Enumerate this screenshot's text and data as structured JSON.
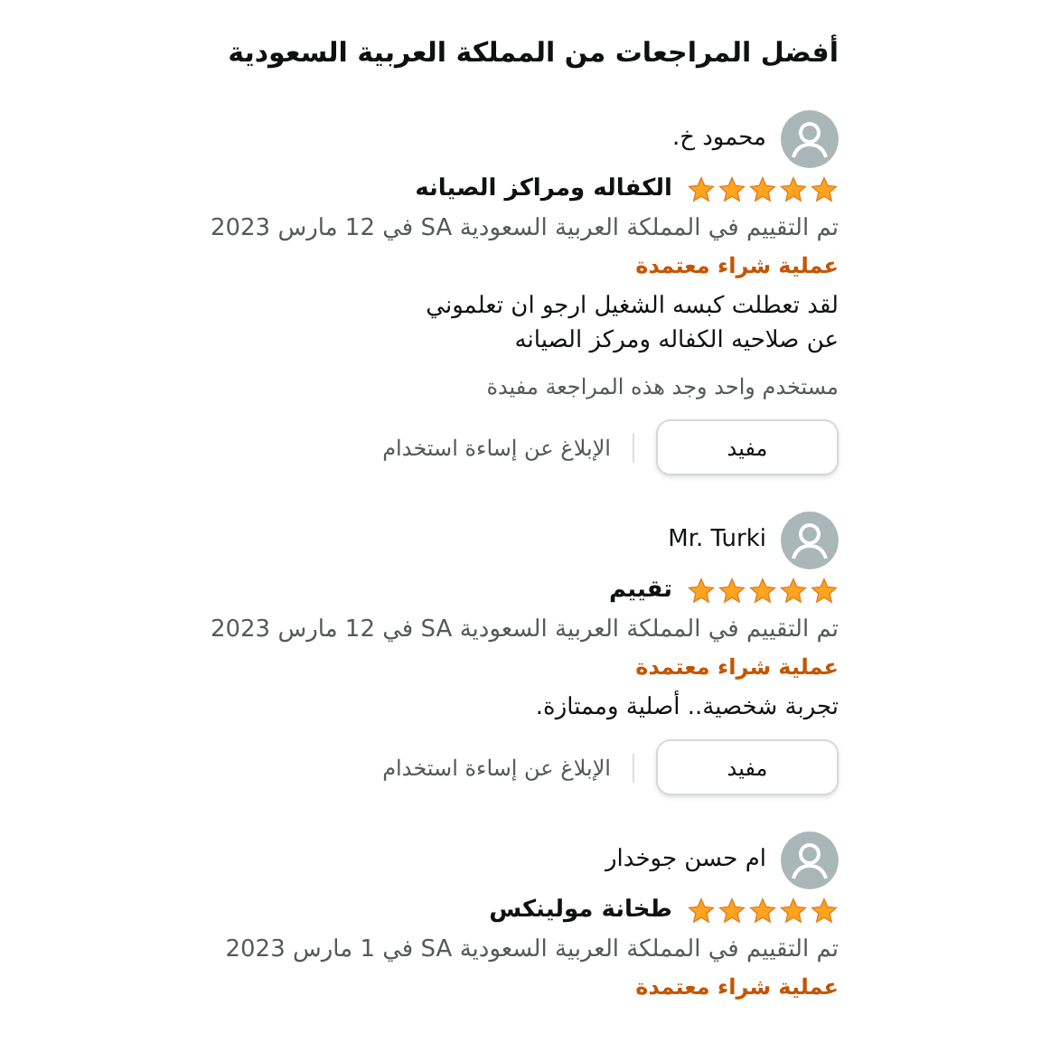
{
  "title": "أفضل المراجعات من المملكة العربية السعودية",
  "reviews": [
    {
      "author": "محمود خ.",
      "stars": 5,
      "headline": "الكفاله ومراكز الصيانه",
      "date": "تم التقييم في المملكة العربية السعودية SA في 12 مارس 2023",
      "badge": "عملية شراء معتمدة",
      "body": [
        "لقد تعطلت كبسه الشغيل ارجو ان تعلموني",
        "عن صلاحيه الكفاله ومركز الصيانه"
      ],
      "helpful_count": "مستخدم واحد وجد هذه المراجعة مفيدة",
      "helpful_button": "مفيد",
      "report": "الإبلاغ عن إساءة استخدام"
    },
    {
      "author": "Mr. Turki",
      "stars": 5,
      "headline": "تقييم",
      "date": "تم التقييم في المملكة العربية السعودية SA في 12 مارس 2023",
      "badge": "عملية شراء معتمدة",
      "body": [
        "تجربة شخصية.. أصلية وممتازة."
      ],
      "helpful_button": "مفيد",
      "report": "الإبلاغ عن إساءة استخدام"
    },
    {
      "author": "ام حسن جوخدار",
      "stars": 5,
      "headline": "طخانة مولينكس",
      "date": "تم التقييم في المملكة العربية السعودية SA في 1 مارس 2023",
      "badge": "عملية شراء معتمدة"
    }
  ]
}
